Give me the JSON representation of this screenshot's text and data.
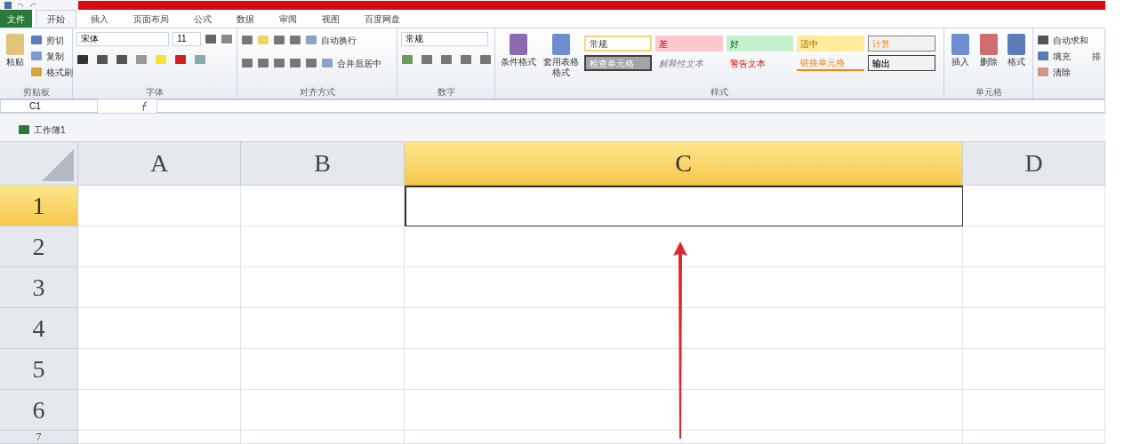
{
  "tabs": [
    {
      "label": "文件",
      "kind": "file",
      "selected": false
    },
    {
      "label": "开始",
      "kind": "tab",
      "selected": true
    },
    {
      "label": "插入",
      "kind": "tab",
      "selected": false
    },
    {
      "label": "页面布局",
      "kind": "tab",
      "selected": false
    },
    {
      "label": "公式",
      "kind": "tab",
      "selected": false
    },
    {
      "label": "数据",
      "kind": "tab",
      "selected": false
    },
    {
      "label": "审阅",
      "kind": "tab",
      "selected": false
    },
    {
      "label": "视图",
      "kind": "tab",
      "selected": false
    },
    {
      "label": "百度网盘",
      "kind": "tab",
      "selected": false
    }
  ],
  "clipboard": {
    "paste": "粘贴",
    "cut": "剪切",
    "copy": "复制",
    "painter": "格式刷",
    "group": "剪贴板"
  },
  "font": {
    "name": "宋体",
    "size": "11",
    "group": "字体"
  },
  "alignment": {
    "wrap": "自动换行",
    "merge": "合并后居中",
    "group": "对齐方式"
  },
  "number": {
    "format": "常规",
    "group": "数字"
  },
  "styles": {
    "conditional": "条件格式",
    "table": "套用表格格式",
    "group": "样式",
    "items": [
      {
        "label": "常规",
        "kind": "normal"
      },
      {
        "label": "差",
        "kind": "bad"
      },
      {
        "label": "好",
        "kind": "good"
      },
      {
        "label": "适中",
        "kind": "neutral"
      },
      {
        "label": "计算",
        "kind": "calculation"
      },
      {
        "label": "检查单元格",
        "kind": "check"
      },
      {
        "label": "解释性文本",
        "kind": "explanatory"
      },
      {
        "label": "警告文本",
        "kind": "warning"
      },
      {
        "label": "链接单元格",
        "kind": "linked"
      },
      {
        "label": "输出",
        "kind": "output"
      }
    ]
  },
  "cells": {
    "insert": "插入",
    "delete": "删除",
    "format": "格式",
    "group": "单元格"
  },
  "editing": {
    "autosum": "自动求和",
    "fill": "填充",
    "clear": "清除",
    "sort": "排"
  },
  "name_box": "C1",
  "workbook_tab": "工作簿1",
  "sheet": {
    "columns": [
      {
        "label": "A",
        "selected": false
      },
      {
        "label": "B",
        "selected": false
      },
      {
        "label": "C",
        "selected": true
      },
      {
        "label": "D",
        "selected": false
      }
    ],
    "rows": [
      {
        "label": "1",
        "selected": true
      },
      {
        "label": "2",
        "selected": false
      },
      {
        "label": "3",
        "selected": false
      },
      {
        "label": "4",
        "selected": false
      },
      {
        "label": "5",
        "selected": false
      },
      {
        "label": "6",
        "selected": false
      },
      {
        "label": "7",
        "selected": false
      }
    ]
  },
  "annotation": {
    "kind": "arrow"
  }
}
